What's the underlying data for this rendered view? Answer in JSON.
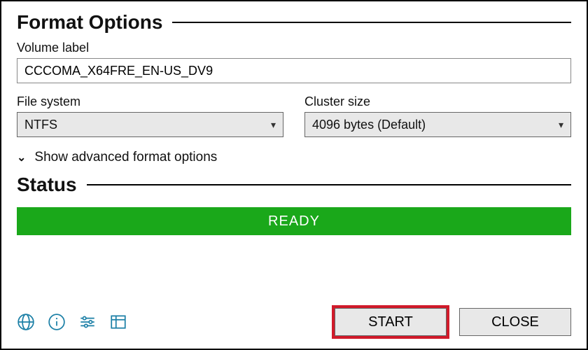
{
  "sections": {
    "format_options_title": "Format Options",
    "status_title": "Status"
  },
  "volume_label": {
    "label": "Volume label",
    "value": "CCCOMA_X64FRE_EN-US_DV9"
  },
  "file_system": {
    "label": "File system",
    "selected": "NTFS"
  },
  "cluster_size": {
    "label": "Cluster size",
    "selected": "4096 bytes (Default)"
  },
  "advanced_toggle": {
    "label": "Show advanced format options"
  },
  "status": {
    "text": "READY"
  },
  "buttons": {
    "start": "START",
    "close": "CLOSE"
  }
}
